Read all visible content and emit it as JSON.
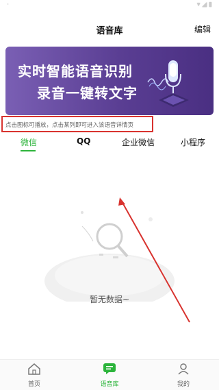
{
  "header": {
    "title": "语音库",
    "edit_label": "编辑"
  },
  "banner": {
    "line1": "实时智能语音识别",
    "line2": "录音一键转文字"
  },
  "hint": {
    "text": "点击图标可播放，点击某列即可进入该语音详情页"
  },
  "tabs": [
    {
      "label": "微信",
      "active": true
    },
    {
      "label": "QQ",
      "active": false
    },
    {
      "label": "企业微信",
      "active": false
    },
    {
      "label": "小程序",
      "active": false
    }
  ],
  "empty_state": {
    "text": "暂无数据~"
  },
  "bottom_nav": [
    {
      "label": "首页",
      "icon": "home-icon",
      "active": false
    },
    {
      "label": "语音库",
      "icon": "voice-library-icon",
      "active": true
    },
    {
      "label": "我的",
      "icon": "profile-icon",
      "active": false
    }
  ],
  "colors": {
    "accent": "#2cb43b",
    "annotation_red": "#d8332f",
    "banner_purple": "#5a3e93"
  }
}
